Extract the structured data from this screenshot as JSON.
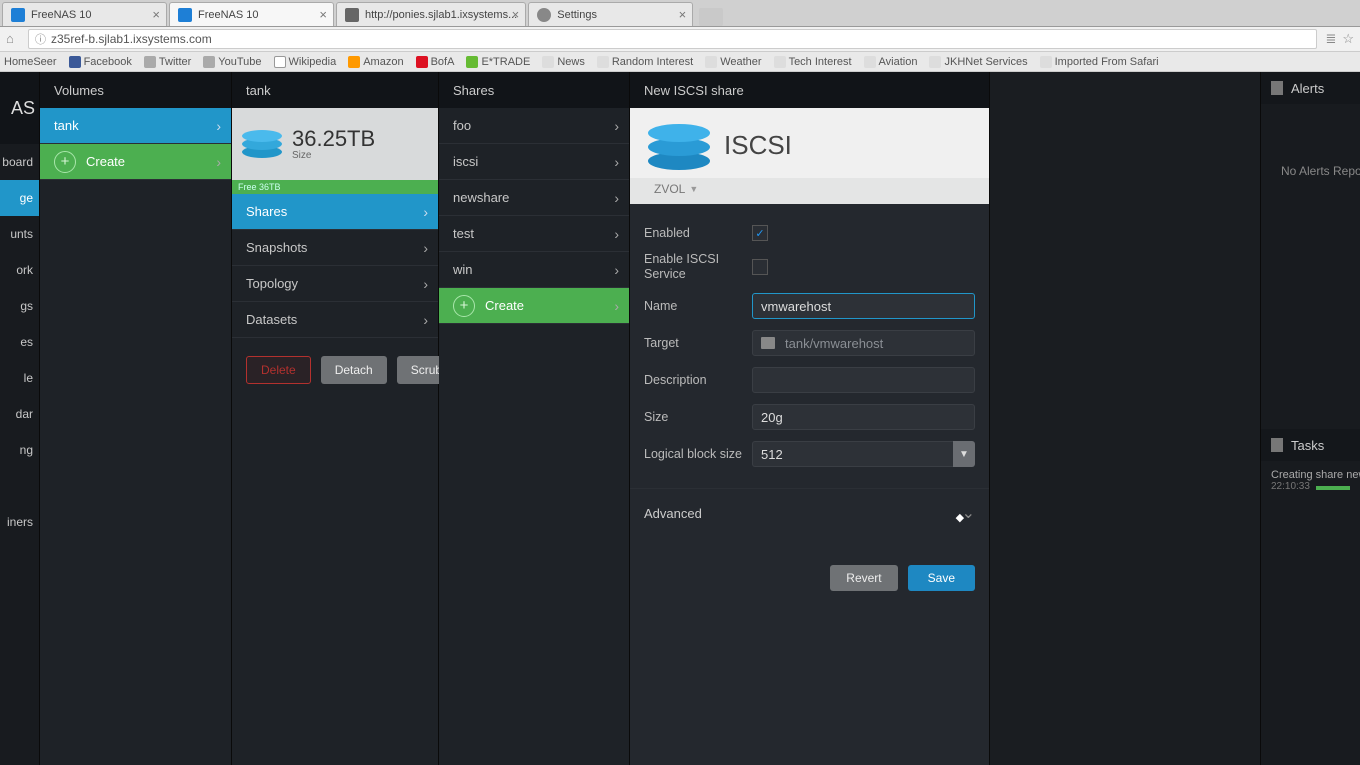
{
  "browser": {
    "tabs": [
      {
        "label": "FreeNAS 10",
        "favicon": "blue"
      },
      {
        "label": "FreeNAS 10",
        "favicon": "blue",
        "active": true
      },
      {
        "label": "http://ponies.sjlab1.ixsystems...",
        "favicon": "gray"
      },
      {
        "label": "Settings",
        "favicon": "gear"
      }
    ],
    "url": "z35ref-b.sjlab1.ixsystems.com",
    "bookmarks": [
      "HomeSeer",
      "Facebook",
      "Twitter",
      "YouTube",
      "Wikipedia",
      "Amazon",
      "BofA",
      "E*TRADE",
      "News",
      "Random Interest",
      "Weather",
      "Tech Interest",
      "Aviation",
      "JKHNet Services",
      "Imported From Safari"
    ]
  },
  "leftnav": {
    "logo": "AS",
    "items": [
      "board",
      "ge",
      "unts",
      "ork",
      "gs",
      "es",
      "le",
      "dar",
      "ng",
      "",
      "iners"
    ],
    "active_index": 1
  },
  "col_volumes": {
    "header": "Volumes",
    "items": [
      "tank"
    ],
    "create": "Create"
  },
  "col_tank": {
    "header": "tank",
    "size": "36.25TB",
    "size_label": "Size",
    "free": "Free 36TB",
    "menu": [
      "Shares",
      "Snapshots",
      "Topology",
      "Datasets"
    ],
    "selected_index": 0,
    "buttons": {
      "delete": "Delete",
      "detach": "Detach",
      "scrub": "Scrub"
    }
  },
  "col_shares": {
    "header": "Shares",
    "items": [
      "foo",
      "iscsi",
      "newshare",
      "test",
      "win"
    ],
    "create": "Create"
  },
  "form": {
    "header": "New ISCSI share",
    "title": "ISCSI",
    "subtype": "ZVOL",
    "fields": {
      "enabled": {
        "label": "Enabled",
        "checked": true
      },
      "enable_service": {
        "label": "Enable ISCSI Service",
        "checked": false
      },
      "name": {
        "label": "Name",
        "value": "vmwarehost"
      },
      "target": {
        "label": "Target",
        "value": "tank/vmwarehost"
      },
      "description": {
        "label": "Description",
        "value": ""
      },
      "size": {
        "label": "Size",
        "value": "20g"
      },
      "lbs": {
        "label": "Logical block size",
        "value": "512"
      }
    },
    "advanced": "Advanced",
    "revert": "Revert",
    "save": "Save"
  },
  "alerts": {
    "header": "Alerts",
    "empty": "No Alerts Repo"
  },
  "tasks": {
    "header": "Tasks",
    "item": "Creating share news",
    "time": "22:10:33"
  }
}
